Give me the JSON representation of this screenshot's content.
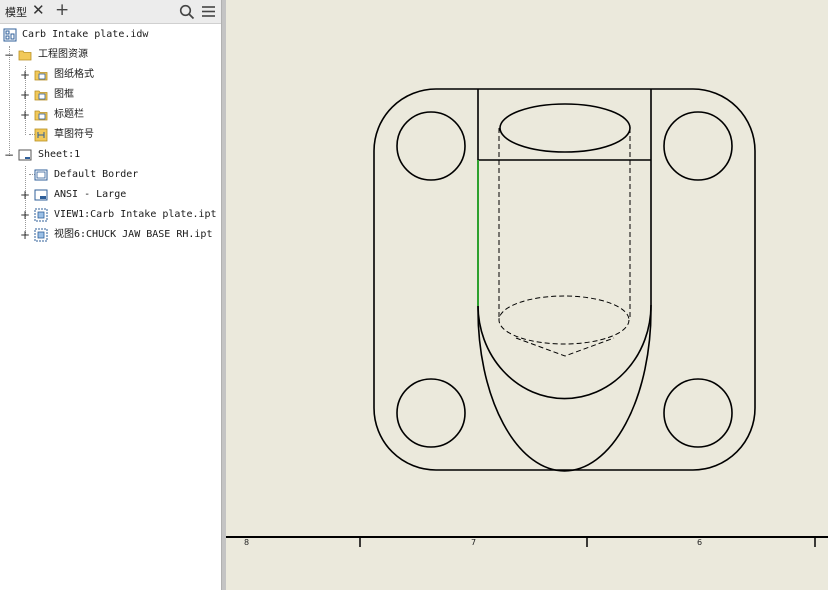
{
  "tabbar": {
    "tab_label": "模型",
    "close_glyph": "✕",
    "add_glyph": "+",
    "search_icon": "search-icon",
    "menu_icon": "hamburger-menu-icon"
  },
  "tree": {
    "root": {
      "label": "Carb Intake plate.idw",
      "icon": "drawing-file-icon"
    },
    "resources": {
      "label": "工程图资源",
      "icon": "folder-icon",
      "children": [
        {
          "label": "图纸格式",
          "icon": "sheet-format-folder-icon"
        },
        {
          "label": "图框",
          "icon": "border-folder-icon"
        },
        {
          "label": "标题栏",
          "icon": "title-block-folder-icon"
        },
        {
          "label": "草图符号",
          "icon": "sketch-symbol-icon"
        }
      ]
    },
    "sheet": {
      "label": "Sheet:1",
      "icon": "sheet-icon",
      "children": [
        {
          "label": "Default Border",
          "icon": "border-icon"
        },
        {
          "label": "ANSI - Large",
          "icon": "title-block-icon"
        },
        {
          "label": "VIEW1:Carb Intake plate.ipt",
          "icon": "drawing-view-icon"
        },
        {
          "label": "视图6:CHUCK JAW BASE RH.ipt",
          "icon": "drawing-view-icon"
        }
      ]
    }
  },
  "canvas": {
    "background": "#ebe9dc",
    "line_color": "#000000",
    "highlight_color": "#2ea02e",
    "ruler_labels": [
      "8",
      "7",
      "6"
    ]
  }
}
